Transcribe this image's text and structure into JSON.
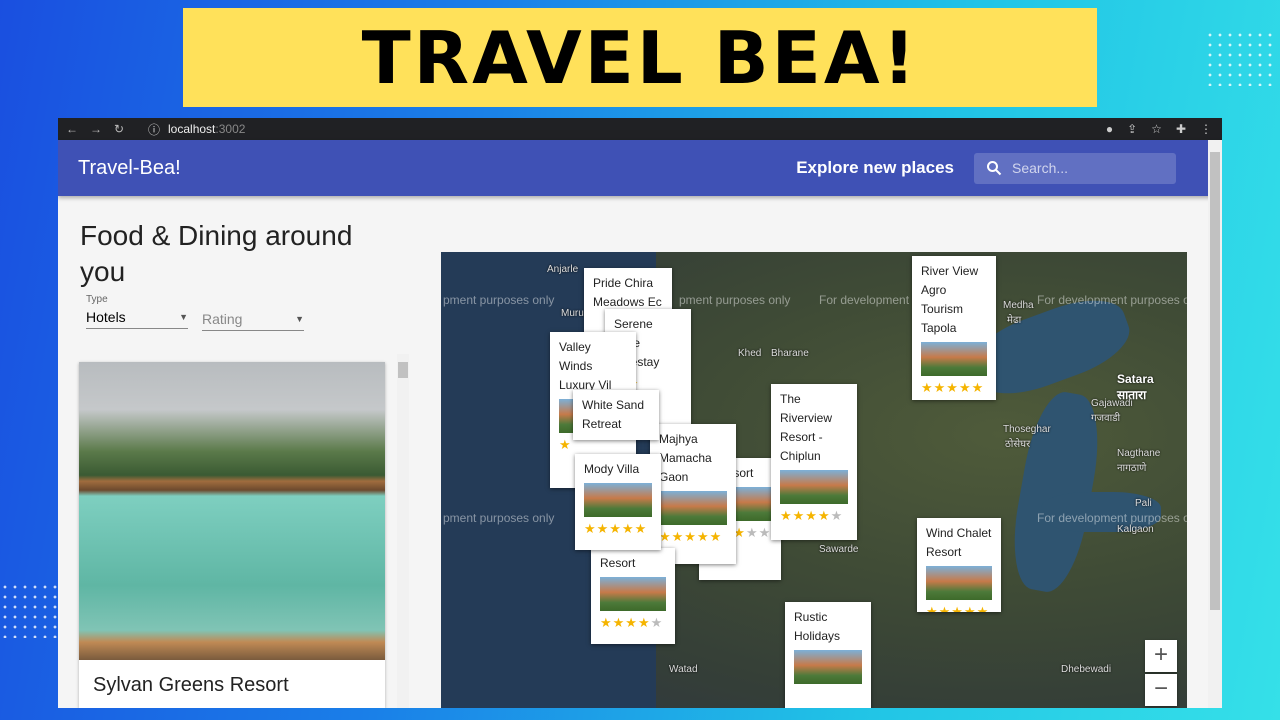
{
  "banner": {
    "title": "TRAVEL BEA!"
  },
  "browser": {
    "url_host": "localhost",
    "url_port": ":3002"
  },
  "appbar": {
    "brand": "Travel-Bea!",
    "explore": "Explore new places",
    "search_placeholder": "Search..."
  },
  "sidebar": {
    "heading": "Food & Dining around you",
    "type_label": "Type",
    "type_value": "Hotels",
    "rating_value": "Rating",
    "featured_place": "Sylvan Greens Resort"
  },
  "map": {
    "watermark": "For development purposes only",
    "watermark_partial": "pment purposes only",
    "towns": [
      "Anjarle",
      "Khed",
      "Bharane",
      "Satara",
      "सातारा",
      "Medha",
      "मेढा",
      "Thoseghar",
      "ठोसेघर",
      "Gajawadi",
      "गजवाडी",
      "Nagthane",
      "नागठाणे",
      "Sawarde",
      "Watad",
      "Dhebewadi",
      "Murud",
      "Pali",
      "Kalgaon"
    ],
    "places": [
      {
        "name": "Pride Chira Meadows Ec",
        "stars": 0
      },
      {
        "name": "Serene ...ine ...nestay",
        "stars": 2
      },
      {
        "name": "Valley Winds Luxury Vil",
        "stars": 1
      },
      {
        "name": "White Sand Retreat",
        "stars": 0
      },
      {
        "name": "Mody Villa",
        "stars": 5
      },
      {
        "name": "Majhya Mamacha Gaon",
        "stars": 5
      },
      {
        "name": "...Resort",
        "stars": 3
      },
      {
        "name": "The Riverview Resort - Chiplun",
        "stars": 4
      },
      {
        "name": "River View Agro Tourism Tapola",
        "stars": 5
      },
      {
        "name": "Wind Chalet Resort",
        "stars": 5
      },
      {
        "name": "Rustic Holidays",
        "stars": 0
      },
      {
        "name": "Resort",
        "stars": 4
      }
    ],
    "zoom_in": "+",
    "zoom_out": "−"
  },
  "colors": {
    "appbar": "#3f51b5",
    "banner": "#ffe15a",
    "star": "#f5b400"
  }
}
